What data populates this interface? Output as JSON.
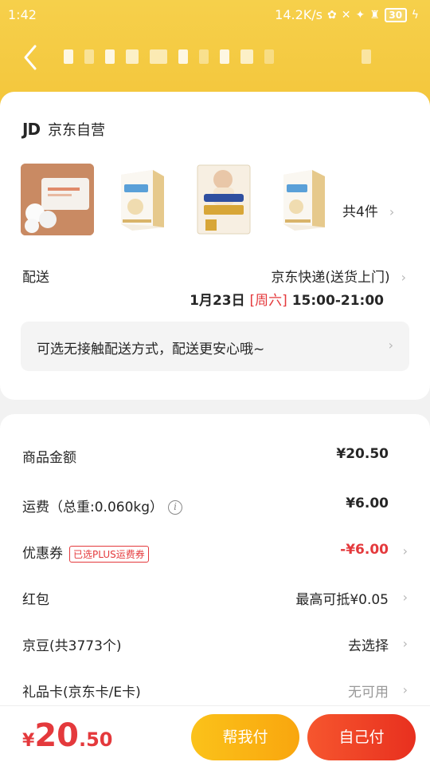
{
  "status_bar": {
    "time": "1:42",
    "speed": "14.2K/s",
    "battery": "30"
  },
  "shop": {
    "logo": "JD",
    "name": "京东自营"
  },
  "products": {
    "count_label": "共4件",
    "images": [
      "cotton-pads",
      "milk-powder-box",
      "moony-diapers",
      "milk-powder-box"
    ]
  },
  "delivery": {
    "label": "配送",
    "method": "京东快递(送货上门)",
    "date": "1月23日",
    "weekday": "[周六]",
    "time_window": "15:00-21:00",
    "contactless_tip": "可选无接触配送方式，配送更安心哦~"
  },
  "summary": {
    "goods_label": "商品金额",
    "goods_value": "¥20.50",
    "shipping_label": "运费（总重:0.060kg）",
    "shipping_value": "¥6.00",
    "coupon_label": "优惠券",
    "coupon_badge": "已选PLUS运费券",
    "coupon_value": "-¥6.00",
    "redpacket_label": "红包",
    "redpacket_value": "最高可抵¥0.05",
    "jingdou_label": "京豆(共3773个)",
    "jingdou_value": "去选择",
    "giftcard_label": "礼品卡(京东卡/E卡)",
    "giftcard_value": "无可用"
  },
  "bottom": {
    "currency": "¥",
    "total_int": "20",
    "total_dec": ".50",
    "help_pay_label": "帮我付",
    "self_pay_label": "自己付"
  },
  "colors": {
    "header": "#f3c53a",
    "accent_red": "#e4393c",
    "help_button": "#f9a60e"
  }
}
